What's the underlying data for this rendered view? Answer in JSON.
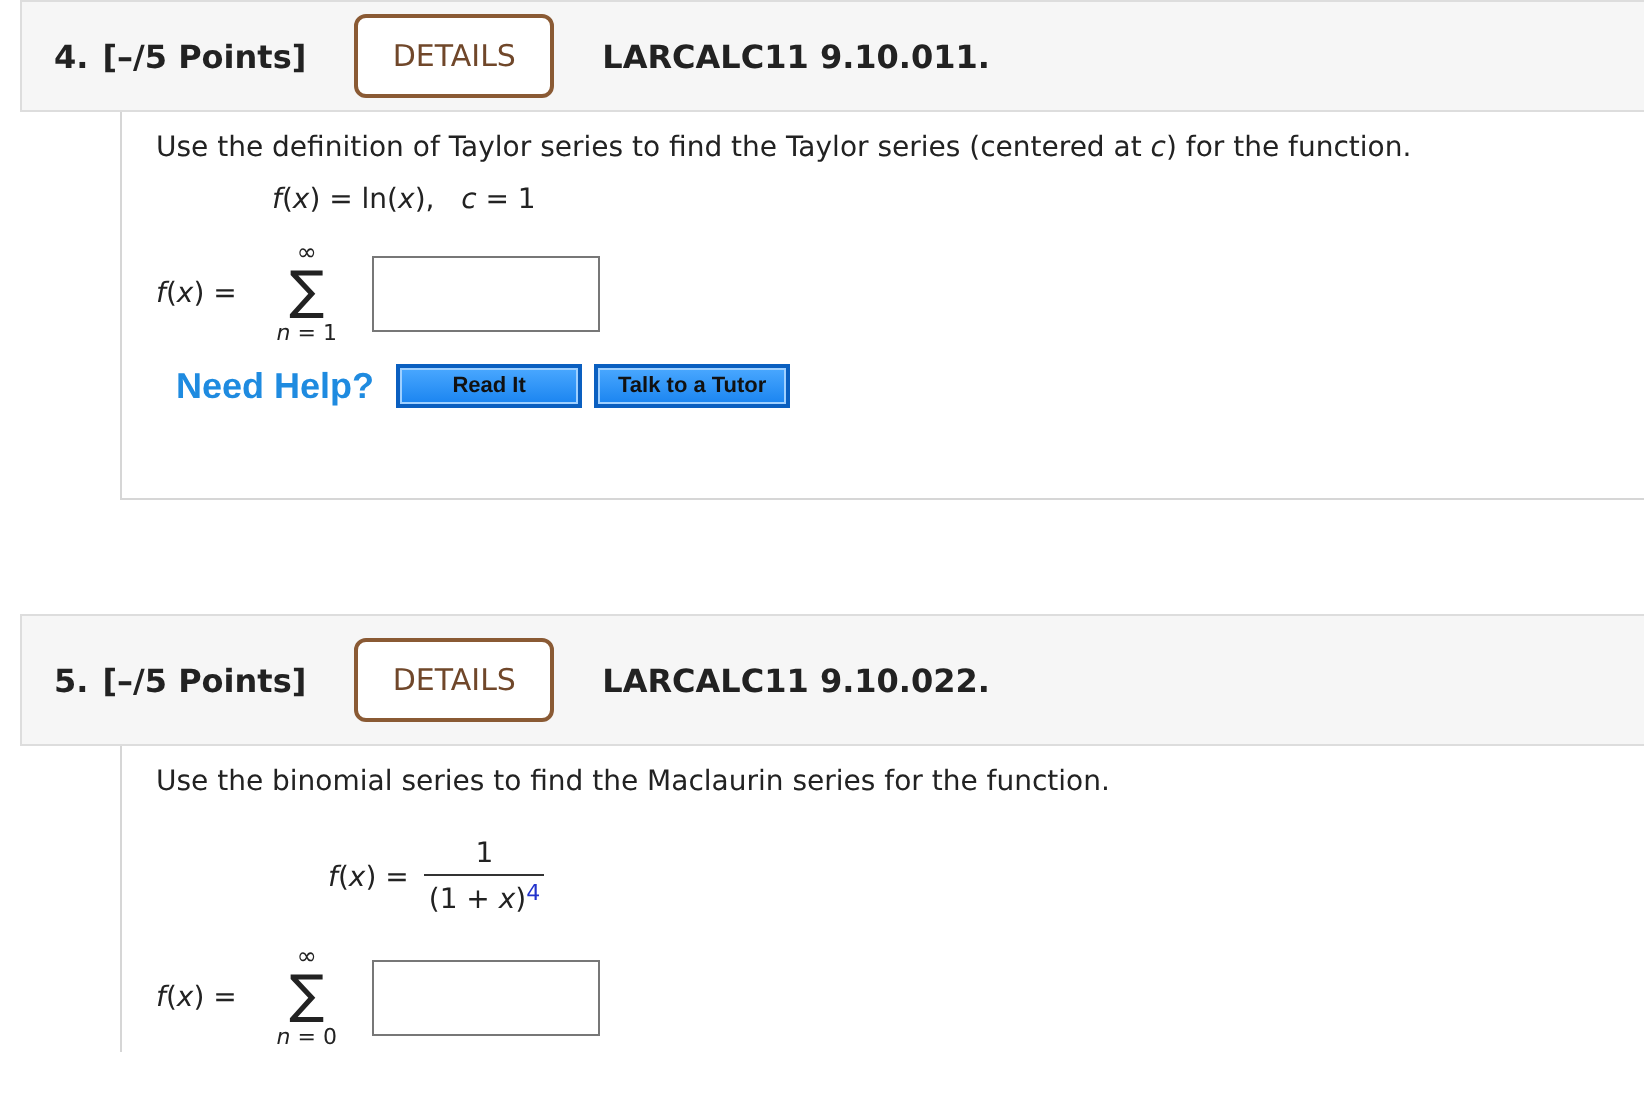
{
  "questions": [
    {
      "number": "4.",
      "points": "[–/5 Points]",
      "details": "DETAILS",
      "code": "LARCALC11 9.10.011.",
      "prompt": "Use the definition of Taylor series to find the Taylor series (centered at *c*) for the function.",
      "given": {
        "kind": "equation",
        "text": "*f*(*x*) = ln(*x*),   *c* = 1"
      },
      "answer": {
        "lhs": "*f*(*x*) =",
        "upper": "∞",
        "sigma": "∑",
        "lower": "*n* = 1"
      },
      "help": {
        "label": "Need Help?",
        "buttons": [
          "Read It",
          "Talk to a Tutor"
        ]
      }
    },
    {
      "number": "5.",
      "points": "[–/5 Points]",
      "details": "DETAILS",
      "code": "LARCALC11 9.10.022.",
      "prompt": "Use the binomial series to find the Maclaurin series for the function.",
      "given": {
        "kind": "fraction",
        "lhs": "*f*(*x*) =",
        "numerator": "1",
        "denominator": "(1 + *x*)",
        "exponent": "4"
      },
      "answer": {
        "lhs": "*f*(*x*) =",
        "upper": "∞",
        "sigma": "∑",
        "lower": "*n* = 0"
      }
    }
  ]
}
